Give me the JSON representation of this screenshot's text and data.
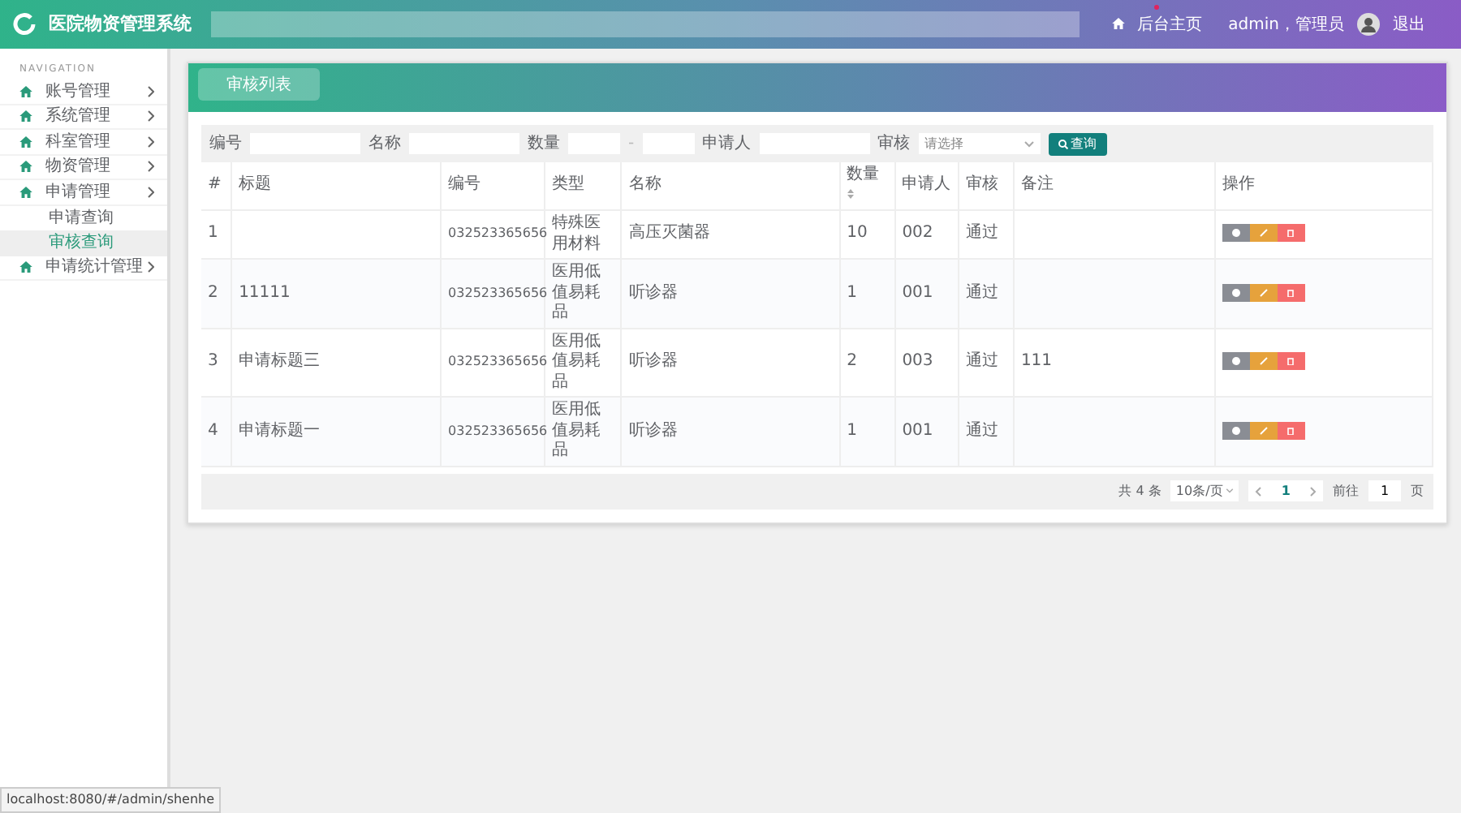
{
  "header": {
    "title": "医院物资管理系统",
    "home_link": "后台主页",
    "user": "admin，管理员",
    "logout": "退出"
  },
  "sidebar": {
    "heading": "NAVIGATION",
    "items": [
      {
        "label": "账号管理"
      },
      {
        "label": "系统管理"
      },
      {
        "label": "科室管理"
      },
      {
        "label": "物资管理"
      },
      {
        "label": "申请管理",
        "children": [
          {
            "label": "申请查询",
            "selected": false
          },
          {
            "label": "审核查询",
            "selected": true
          }
        ]
      },
      {
        "label": "申请统计管理"
      }
    ]
  },
  "tabs": [
    {
      "label": "审核列表",
      "selected": true
    }
  ],
  "filters": {
    "code_label": "编号",
    "name_label": "名称",
    "quantity_label": "数量",
    "quantity_separator": "-",
    "applicant_label": "申请人",
    "status_label": "审核",
    "status_placeholder": "请选择",
    "search_button": "查询"
  },
  "table": {
    "columns": [
      "#",
      "标题",
      "编号",
      "类型",
      "名称",
      "数量",
      "申请人",
      "审核",
      "备注",
      "操作"
    ],
    "rows": [
      {
        "index": "1",
        "title": "",
        "code": "032523365656",
        "type": "特殊医用材料",
        "name": "高压灭菌器",
        "quantity": "10",
        "applicant": "002",
        "status": "通过",
        "remark": ""
      },
      {
        "index": "2",
        "title": "11111",
        "code": "032523365656",
        "type": "医用低值易耗品",
        "name": "听诊器",
        "quantity": "1",
        "applicant": "001",
        "status": "通过",
        "remark": ""
      },
      {
        "index": "3",
        "title": "申请标题三",
        "code": "032523365656",
        "type": "医用低值易耗品",
        "name": "听诊器",
        "quantity": "2",
        "applicant": "003",
        "status": "通过",
        "remark": "111"
      },
      {
        "index": "4",
        "title": "申请标题一",
        "code": "032523365656",
        "type": "医用低值易耗品",
        "name": "听诊器",
        "quantity": "1",
        "applicant": "001",
        "status": "通过",
        "remark": ""
      }
    ]
  },
  "pagination": {
    "total": "共 4 条",
    "page_size": "10条/页",
    "pages": [
      {
        "label": "1",
        "selected": true
      }
    ],
    "goto_label": "前往",
    "goto_value": "1",
    "goto_suffix": "页"
  },
  "status_url": "localhost:8080/#/admin/shenhe"
}
